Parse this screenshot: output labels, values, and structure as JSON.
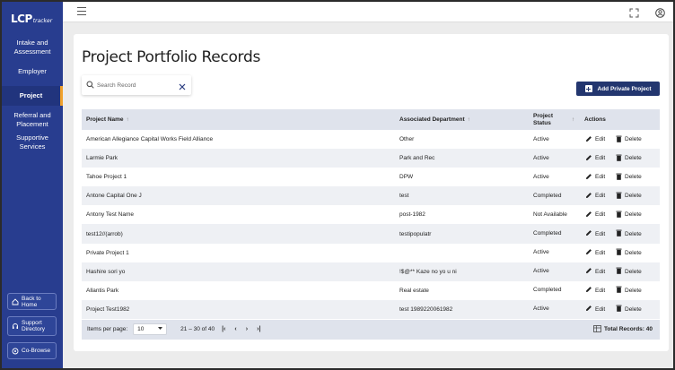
{
  "app": {
    "logo_main": "LCP",
    "logo_sub": "tracker"
  },
  "sidebar": {
    "items": [
      {
        "label": "Intake and Assessment",
        "active": false
      },
      {
        "label": "Employer",
        "active": false
      },
      {
        "label": "Project",
        "active": true
      },
      {
        "label": "Referral and Placement",
        "active": false
      },
      {
        "label": "Supportive Services",
        "active": false
      }
    ],
    "back_home": "Back to Home",
    "support_directory": "Support Directory",
    "co_browse": "Co-Browse"
  },
  "page": {
    "title": "Project Portfolio Records"
  },
  "search": {
    "placeholder": "Search Record",
    "value": ""
  },
  "add_button": "Add Private Project",
  "table": {
    "headers": {
      "name": "Project Name",
      "department": "Associated Department",
      "status": "Project Status",
      "actions": "Actions"
    },
    "edit_label": "Edit",
    "delete_label": "Delete",
    "rows": [
      {
        "name": "American Allegiance Capital Works Field Alliance",
        "department": "Other",
        "status": "Active"
      },
      {
        "name": "Larmie Park",
        "department": "Park and Rec",
        "status": "Active"
      },
      {
        "name": "Tahoe Project 1",
        "department": "DPW",
        "status": "Active"
      },
      {
        "name": "Antone Capital One J",
        "department": "test",
        "status": "Completed"
      },
      {
        "name": "Antony Test Name",
        "department": "post-1982",
        "status": "Not Available"
      },
      {
        "name": "test12//(arrob)",
        "department": "testipopulatr",
        "status": "Completed"
      },
      {
        "name": "Private Project 1",
        "department": "",
        "status": "Active"
      },
      {
        "name": "Hashire sori yo",
        "department": "!$@** Kaze no yo u ni",
        "status": "Active"
      },
      {
        "name": "Allantis Park",
        "department": "Real estate",
        "status": "Completed"
      },
      {
        "name": "Project Test1982",
        "department": "test 1989220061982",
        "status": "Active"
      }
    ]
  },
  "footer": {
    "items_per_page_label": "Items per page:",
    "items_per_page_value": "10",
    "range": "21 – 30 of 40",
    "total_records": "Total Records: 40"
  },
  "colors": {
    "sidebar_bg": "#283d8f",
    "primary_button": "#23366f",
    "active_indicator": "#f0a12b",
    "table_header_bg": "#dfe3ec"
  }
}
